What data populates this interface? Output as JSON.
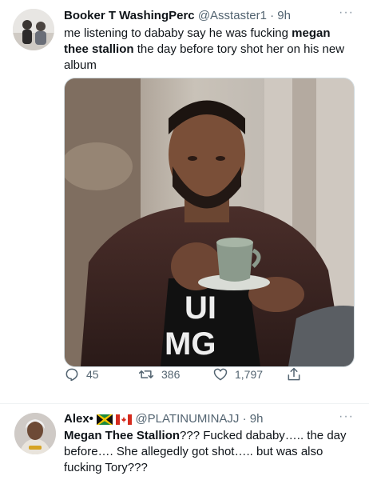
{
  "tweet1": {
    "display_name": "Booker T WashingPerc",
    "handle": "@Asstaster1",
    "separator": "·",
    "time": "9h",
    "text_1": "me listening to dababy say he was fucking ",
    "text_bold": "megan thee stallion",
    "text_2": " the day before tory shot her on his new album",
    "actions": {
      "reply_count": "45",
      "retweet_count": "386",
      "like_count": "1,797"
    }
  },
  "tweet2": {
    "display_name": "Alex•",
    "handle": "@PLATINUMINAJJ",
    "separator": "·",
    "time": "9h",
    "text_bold": "Megan Thee Stallion",
    "text_1": "??? Fucked dababy….. the day before…. She allegedly got shot….. but was also fucking Tory???"
  },
  "icons": {
    "more": "more-dots-icon",
    "reply": "reply-icon",
    "retweet": "retweet-icon",
    "like": "heart-icon",
    "share": "share-icon"
  },
  "colors": {
    "text": "#0f1419",
    "muted": "#536471",
    "divider": "#eff3f4"
  }
}
